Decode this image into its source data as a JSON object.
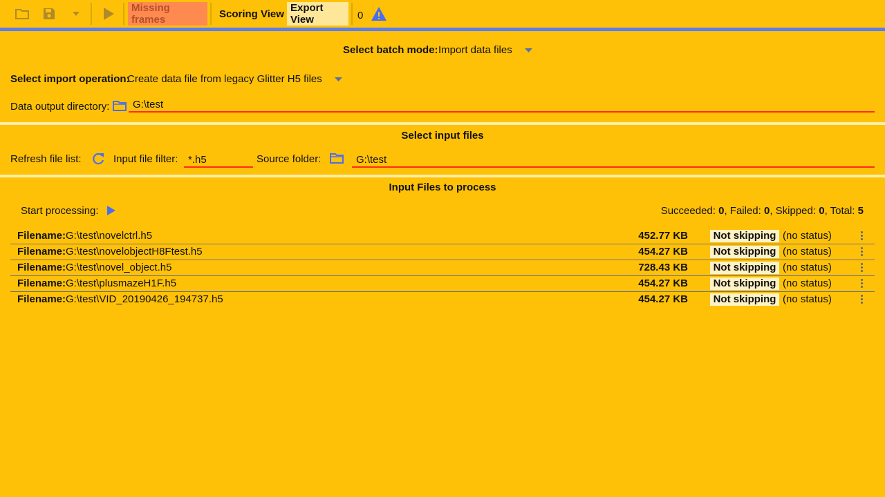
{
  "toolbar": {
    "missing_frames_label": "Missing frames",
    "scoring_view_label": "Scoring View",
    "export_view_label": "Export View",
    "warning_count": "0",
    "icons": [
      "folder-open-icon",
      "save-icon",
      "dropdown-icon",
      "play-icon",
      "warning-icon"
    ],
    "colors": {
      "missing_frames_bg": "#FF8A50",
      "missing_frames_text": "#B5502A",
      "export_view_bg": "#FFE79A"
    }
  },
  "batch": {
    "mode_label": "Select batch mode:",
    "mode_value": "Import data files",
    "import_op_label": "Select import operation:",
    "import_op_value": "Create data file from legacy Glitter H5 files",
    "output_dir_label": "Data output directory:",
    "output_dir_value": "G:\\test"
  },
  "input_files": {
    "section_title": "Select input files",
    "refresh_label": "Refresh file list:",
    "filter_label": "Input file filter:",
    "filter_value": "*.h5",
    "source_label": "Source folder:",
    "source_value": "G:\\test"
  },
  "process": {
    "section_title": "Input Files to process",
    "start_label": "Start processing:",
    "succeeded_label": "Succeeded:",
    "succeeded_value": "0",
    "failed_label": ", Failed:",
    "failed_value": "0",
    "skipped_label": ", Skipped:",
    "skipped_value": "0",
    "total_label": ", Total:",
    "total_value": "5"
  },
  "files": [
    {
      "label": "Filename:",
      "name": "G:\\test\\novelctrl.h5",
      "size": "452.77 KB",
      "skip": "Not skipping",
      "status": "(no status)"
    },
    {
      "label": "Filename:",
      "name": "G:\\test\\novelobjectH8Ftest.h5",
      "size": "454.27 KB",
      "skip": "Not skipping",
      "status": "(no status)"
    },
    {
      "label": "Filename:",
      "name": "G:\\test\\novel_object.h5",
      "size": "728.43 KB",
      "skip": "Not skipping",
      "status": "(no status)"
    },
    {
      "label": "Filename:",
      "name": "G:\\test\\plusmazeH1F.h5",
      "size": "454.27 KB",
      "skip": "Not skipping",
      "status": "(no status)"
    },
    {
      "label": "Filename:",
      "name": "G:\\test\\VID_20190426_194737.h5",
      "size": "454.27 KB",
      "skip": "Not skipping",
      "status": "(no status)"
    }
  ],
  "colors": {
    "background": "#FFC107",
    "accent_blue": "#5b7cf2",
    "field_underline": "#FF2A1A",
    "divider": "#FFEFA8"
  }
}
